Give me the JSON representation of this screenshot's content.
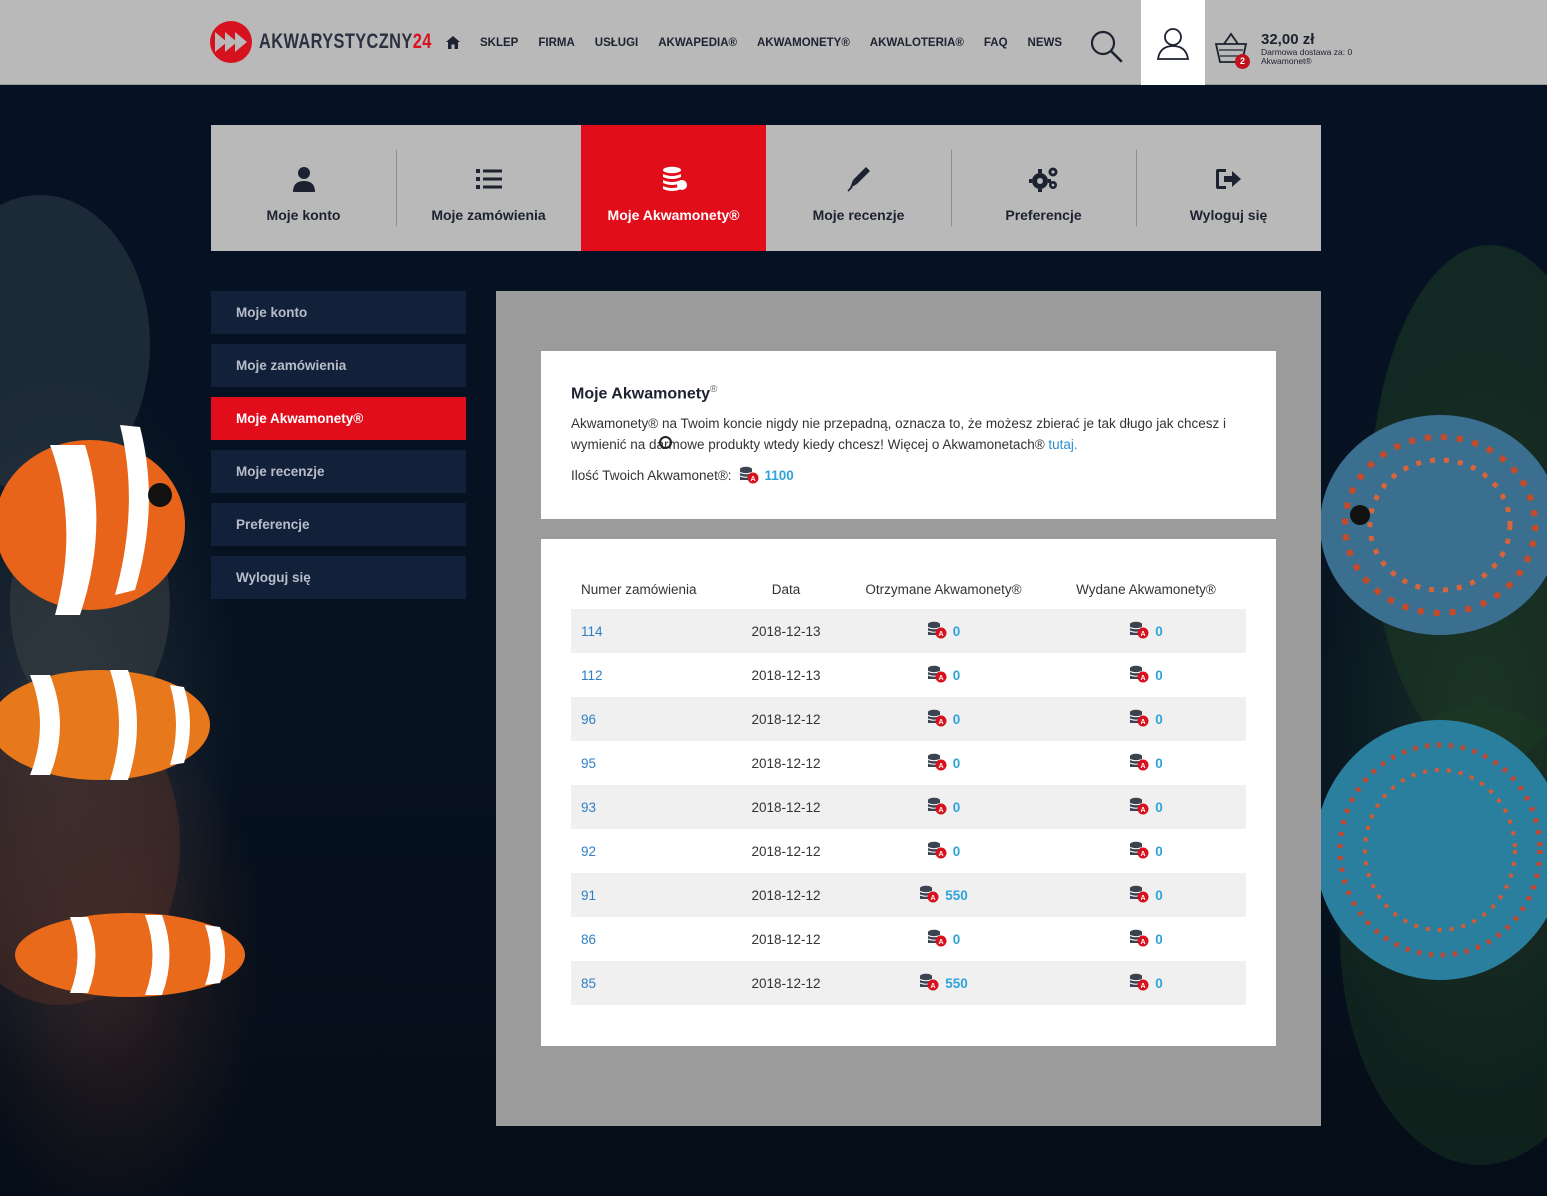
{
  "header": {
    "logo_text": "AKWARYSTYCZNY",
    "logo_number": "24",
    "nav": [
      "SKLEP",
      "FIRMA",
      "USŁUGI",
      "AKWAPEDIA®",
      "AKWAMONETY®",
      "AKWALOTERIA®",
      "FAQ",
      "NEWS"
    ],
    "cart_badge": "2",
    "cart_total": "32,00 zł",
    "cart_free_line1": "Darmowa dostawa za: 0",
    "cart_free_line2": "Akwamonet®"
  },
  "tabs": [
    {
      "label": "Moje konto",
      "icon": "user-icon"
    },
    {
      "label": "Moje zamówienia",
      "icon": "list-icon"
    },
    {
      "label": "Moje Akwamonety®",
      "icon": "coins-icon",
      "active": true
    },
    {
      "label": "Moje recenzje",
      "icon": "pen-icon"
    },
    {
      "label": "Preferencje",
      "icon": "gears-icon"
    },
    {
      "label": "Wyloguj się",
      "icon": "logout-icon"
    }
  ],
  "side_menu": [
    "Moje konto",
    "Moje zamówienia",
    "Moje Akwamonety®",
    "Moje recenzje",
    "Preferencje",
    "Wyloguj się"
  ],
  "info": {
    "title": "Moje Akwamonety",
    "title_sup": "®",
    "desc": "Akwamonety® na Twoim koncie nigdy nie przepadną, oznacza to, że możesz zbierać je tak długo jak chcesz i wymienić na darmowe produkty wtedy kiedy chcesz! Więcej o Akwamonetach® ",
    "link": "tutaj.",
    "balance_label": "Ilość Twoich Akwamonet®:",
    "balance_value": "1100"
  },
  "table": {
    "headers": [
      "Numer zamówienia",
      "Data",
      "Otrzymane Akwamonety®",
      "Wydane Akwamonety®"
    ],
    "rows": [
      {
        "order": "114",
        "date": "2018-12-13",
        "received": "0",
        "spent": "0"
      },
      {
        "order": "112",
        "date": "2018-12-13",
        "received": "0",
        "spent": "0"
      },
      {
        "order": "96",
        "date": "2018-12-12",
        "received": "0",
        "spent": "0"
      },
      {
        "order": "95",
        "date": "2018-12-12",
        "received": "0",
        "spent": "0"
      },
      {
        "order": "93",
        "date": "2018-12-12",
        "received": "0",
        "spent": "0"
      },
      {
        "order": "92",
        "date": "2018-12-12",
        "received": "0",
        "spent": "0"
      },
      {
        "order": "91",
        "date": "2018-12-12",
        "received": "550",
        "spent": "0"
      },
      {
        "order": "86",
        "date": "2018-12-12",
        "received": "0",
        "spent": "0"
      },
      {
        "order": "85",
        "date": "2018-12-12",
        "received": "550",
        "spent": "0"
      }
    ]
  },
  "colors": {
    "accent": "#e10d1b",
    "navy": "#12203a",
    "link": "#2f8fd0"
  }
}
